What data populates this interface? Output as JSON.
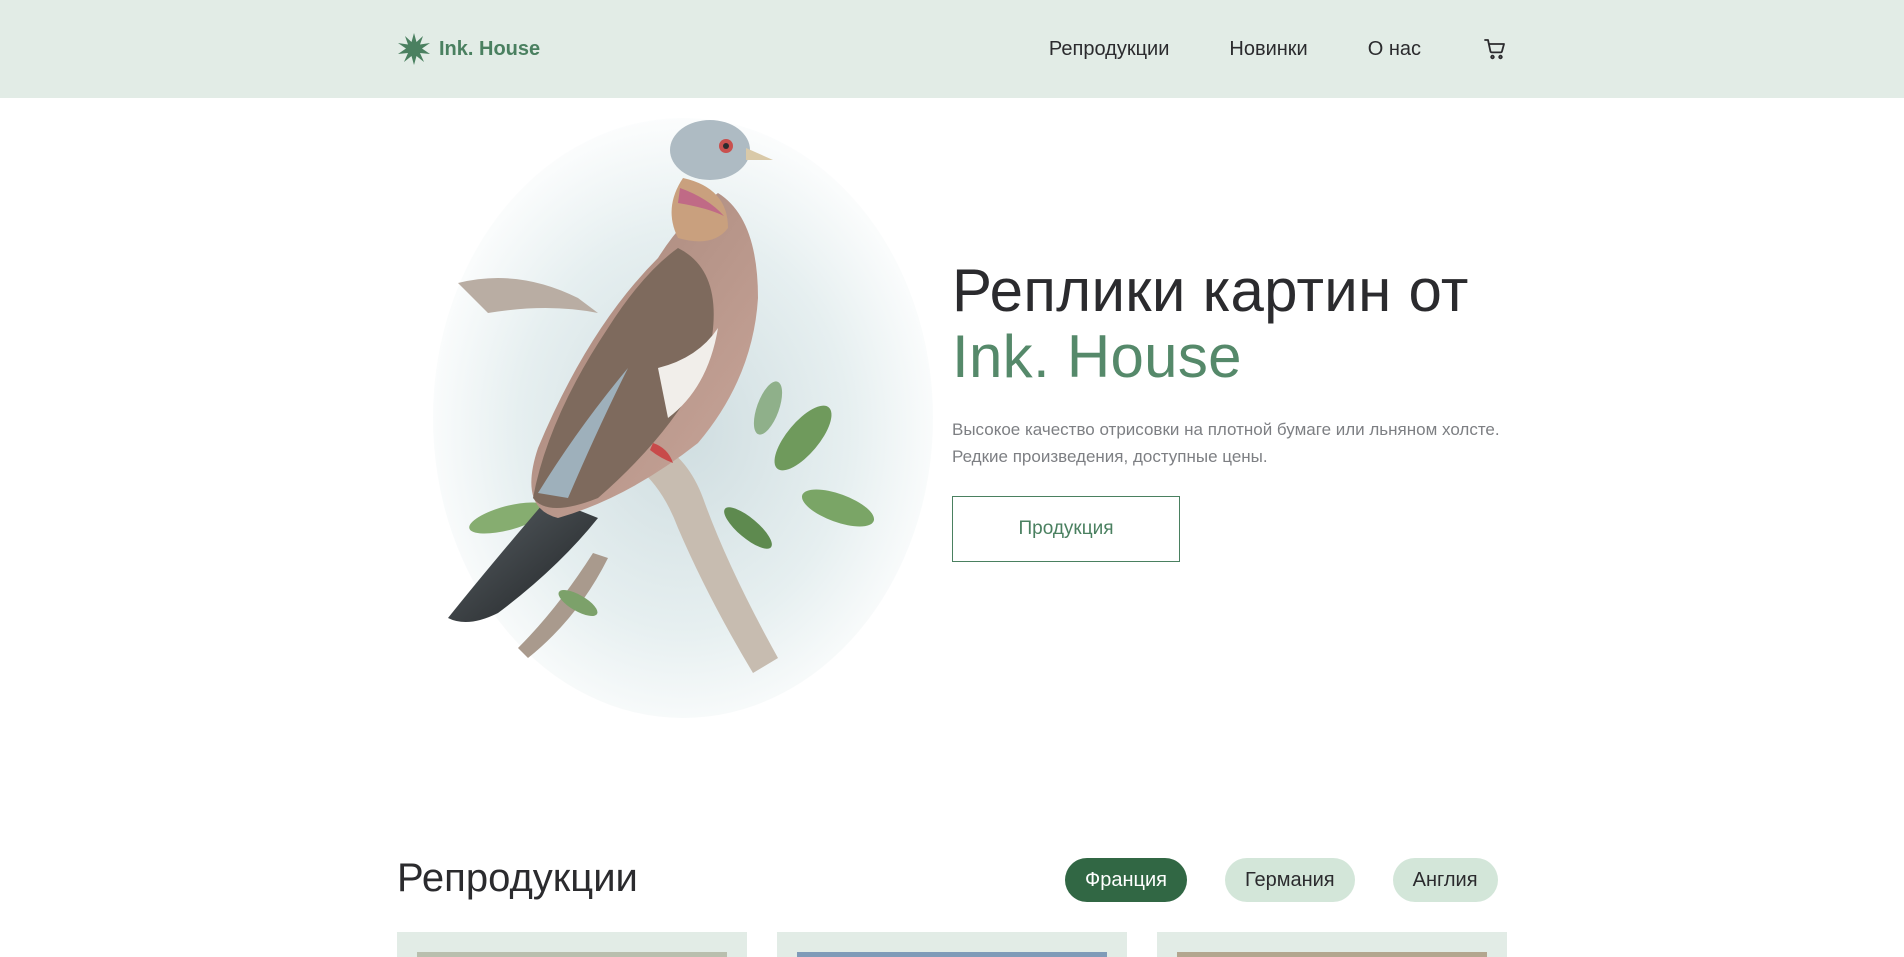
{
  "header": {
    "logo_text": "Ink. House",
    "logo_icon": "starburst-icon",
    "nav": [
      "Репродукции",
      "Новинки",
      "О нас"
    ],
    "cart_icon": "cart-icon"
  },
  "hero": {
    "title_line1": "Реплики картин от",
    "title_line2": "Ink. House",
    "description": "Высокое качество отрисовки на плотной бумаге или льняном холсте. Редкие произведения, доступные цены.",
    "button_label": "Продукция",
    "image": "pigeon-illustration"
  },
  "reproductions": {
    "title": "Репродукции",
    "filters": [
      {
        "label": "Франция",
        "active": true
      },
      {
        "label": "Германия",
        "active": false
      },
      {
        "label": "Англия",
        "active": false
      }
    ]
  },
  "colors": {
    "header_bg": "#e2ece6",
    "accent": "#55896a",
    "active_chip": "#316744",
    "chip": "#d3e6d9"
  }
}
